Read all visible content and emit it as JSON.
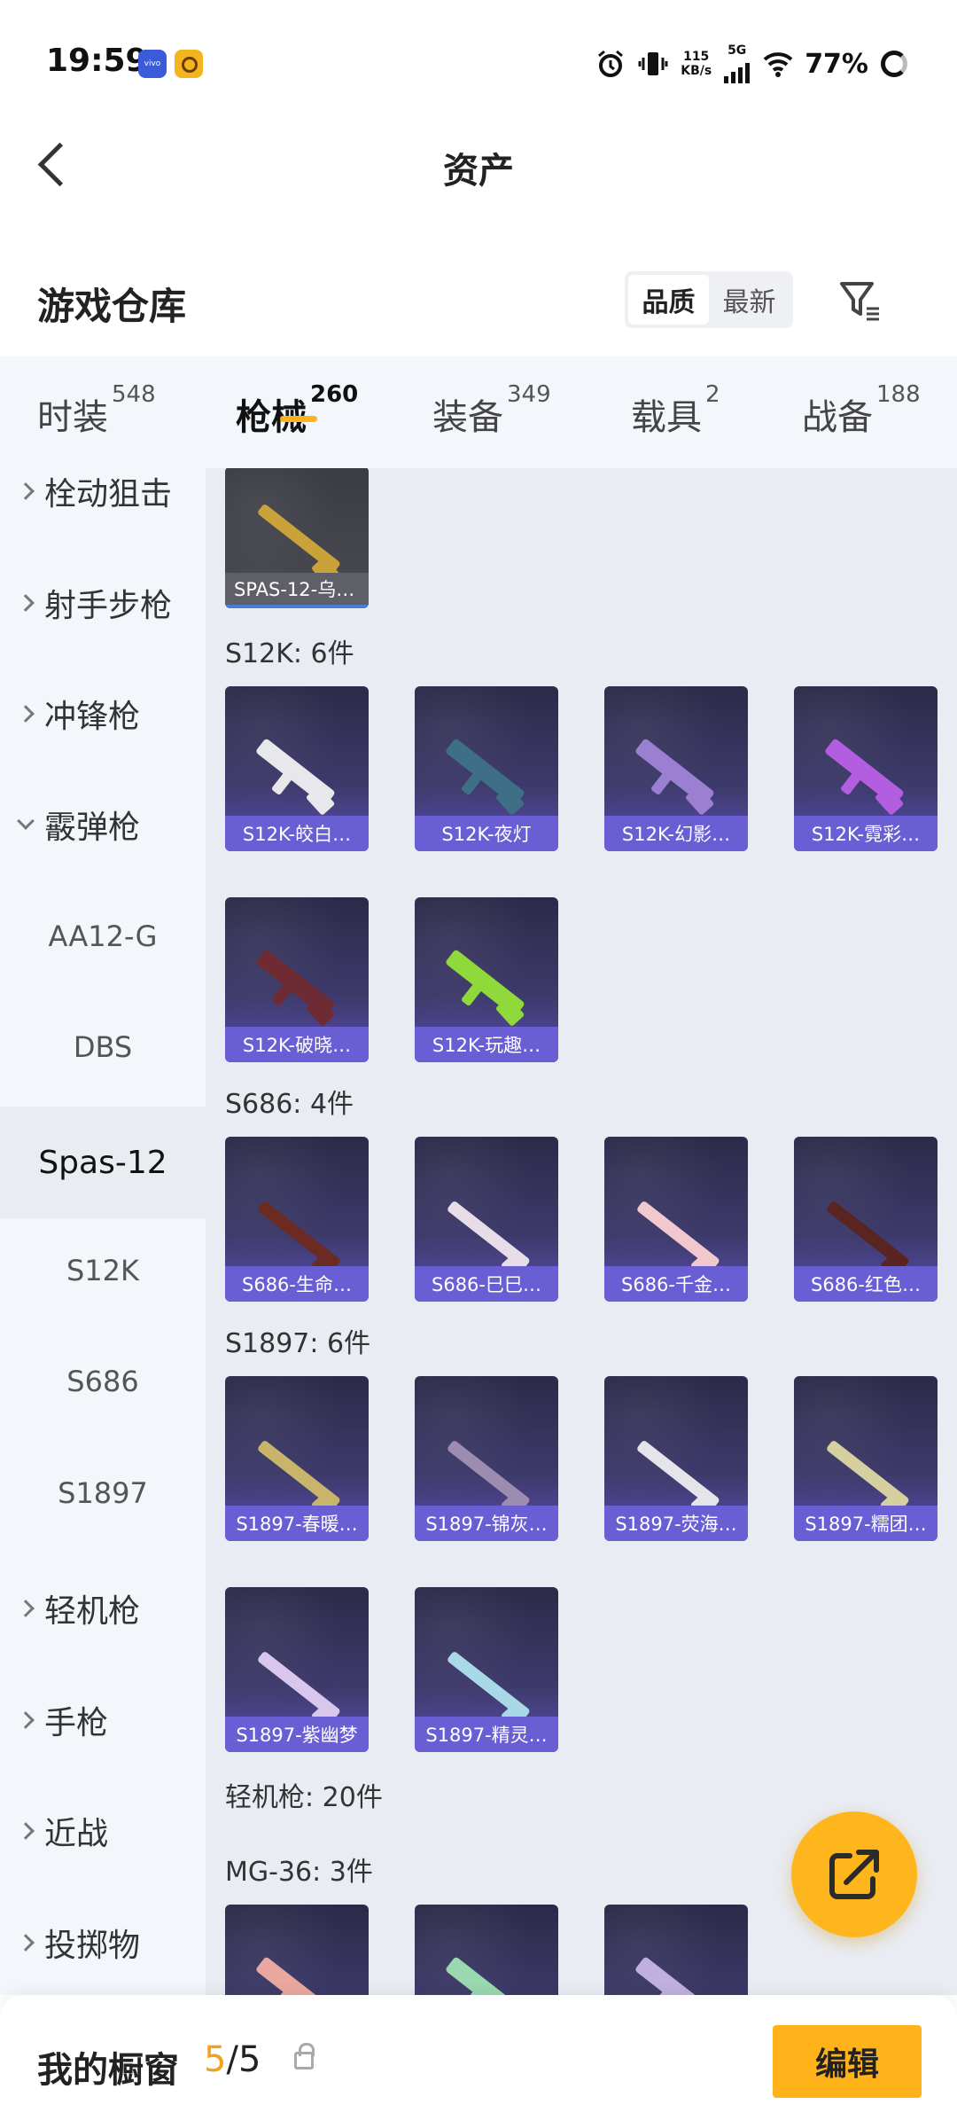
{
  "status_bar": {
    "time": "19:59",
    "app_badge_1": "vivo",
    "speed_top": "115",
    "speed_bottom": "KB/s",
    "network": "5G",
    "battery": "77%"
  },
  "header": {
    "title": "资产"
  },
  "warehouse": {
    "title": "游戏仓库",
    "sort_options": [
      "品质",
      "最新"
    ],
    "sort_selected": "品质"
  },
  "categories": [
    {
      "label": "时装",
      "count": "548"
    },
    {
      "label": "枪械",
      "count": "260",
      "active": true
    },
    {
      "label": "装备",
      "count": "349"
    },
    {
      "label": "载具",
      "count": "2"
    },
    {
      "label": "战备",
      "count": "188"
    }
  ],
  "sidebar": {
    "items": [
      {
        "label": "栓动狙击"
      },
      {
        "label": "射手步枪"
      },
      {
        "label": "冲锋枪"
      },
      {
        "label": "霰弹枪",
        "expanded": true
      },
      {
        "label": "AA12-G"
      },
      {
        "label": "DBS"
      },
      {
        "label": "Spas-12",
        "selected": true
      },
      {
        "label": "S12K"
      },
      {
        "label": "S686"
      },
      {
        "label": "S1897"
      },
      {
        "label": "轻机枪"
      },
      {
        "label": "手枪"
      },
      {
        "label": "近战"
      },
      {
        "label": "投掷物"
      }
    ]
  },
  "content": {
    "top_card": "SPAS-12-乌…",
    "groups": [
      {
        "label": "S12K: 6件",
        "items": [
          "S12K-皎白…",
          "S12K-夜灯",
          "S12K-幻影…",
          "S12K-霓彩…",
          "S12K-破晓…",
          "S12K-玩趣…"
        ]
      },
      {
        "label": "S686: 4件",
        "items": [
          "S686-生命…",
          "S686-巳巳…",
          "S686-千金…",
          "S686-红色…"
        ]
      },
      {
        "label": "S1897: 6件",
        "items": [
          "S1897-春暖…",
          "S1897-锦灰…",
          "S1897-荧海…",
          "S1897-糯团…",
          "S1897-紫幽梦",
          "S1897-精灵…"
        ]
      }
    ],
    "section_label": "轻机枪: 20件",
    "subgroup_label": "MG-36: 3件"
  },
  "bottom_bar": {
    "label": "我的橱窗",
    "count_current": "5",
    "count_sep": "/",
    "count_total": "5",
    "edit_label": "编辑"
  },
  "colors": {
    "accent": "#ffb21a",
    "card_purple": "#6a5ed4",
    "tab_bg": "#f3f7fb",
    "content_bg": "#e9ecf3"
  },
  "icons": [
    "back-arrow-icon",
    "filter-icon",
    "alarm-icon",
    "vibrate-icon",
    "wifi-icon",
    "battery-icon",
    "lock-icon",
    "share-icon"
  ]
}
